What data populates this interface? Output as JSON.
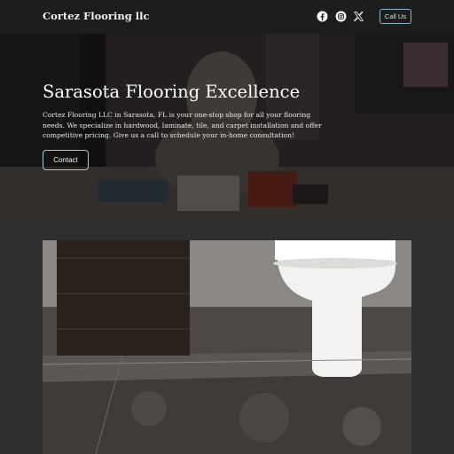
{
  "header": {
    "brand": "Cortez Flooring llc",
    "social_icons": [
      "facebook-icon",
      "instagram-icon",
      "x-icon"
    ],
    "call_label": "Call Us"
  },
  "hero": {
    "title": "Sarasota Flooring Excellence",
    "description": "Cortez Flooring LLC in Sarasota, FL is your one-stop shop for all your flooring needs. We specialize in hardwood, laminate, tile, and carpet installation and offer competitive pricing. Give us a call to schedule your in-home consultation!",
    "contact_label": "Contact"
  },
  "colors": {
    "header_bg": "#1d1d1d",
    "page_bg": "#2f2f2f",
    "button_border": "#8db7c2"
  }
}
